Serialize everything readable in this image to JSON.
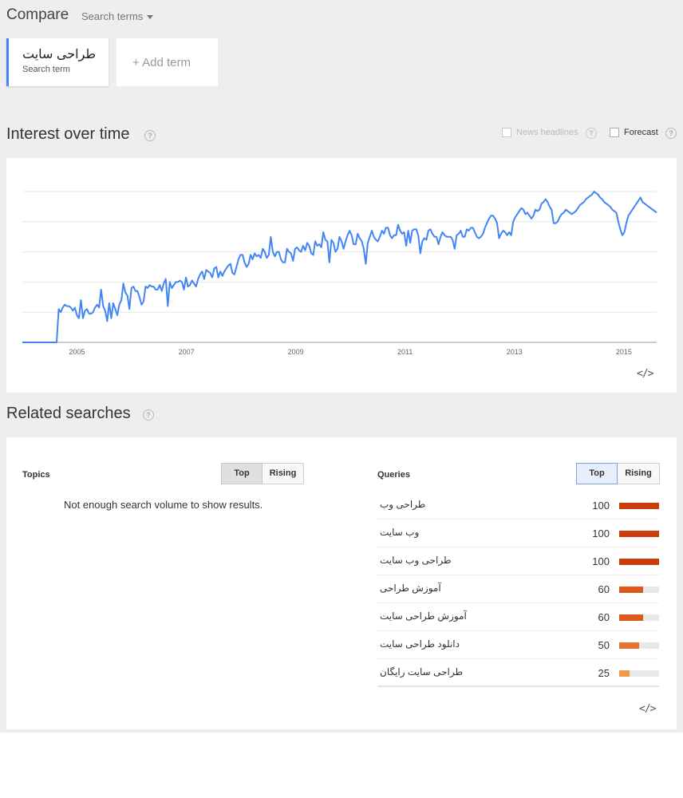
{
  "header": {
    "compare_title": "Compare",
    "search_terms_label": "Search terms",
    "term": {
      "text": "طراحی سایت",
      "sub": "Search term",
      "accent": "#4285f4"
    },
    "add_term": "+ Add term"
  },
  "interest": {
    "title": "Interest over time",
    "news_headlines": "News headlines",
    "forecast": "Forecast",
    "help": "?"
  },
  "chart_data": {
    "type": "line",
    "x_start": 2004.0,
    "x_end": 2015.6,
    "x_ticks": [
      "2005",
      "2007",
      "2009",
      "2011",
      "2013",
      "2015"
    ],
    "x_tick_values": [
      2005,
      2007,
      2009,
      2011,
      2013,
      2015
    ],
    "ylim": [
      0,
      100
    ],
    "grid": true,
    "line_color": "#4285f4",
    "series": [
      {
        "values": [
          0,
          0,
          0,
          0,
          0,
          0,
          0,
          0,
          0,
          0,
          0,
          0,
          0,
          0,
          0,
          0,
          0,
          0,
          22,
          20,
          23,
          25,
          24,
          24,
          23,
          21,
          23,
          18,
          16,
          28,
          16,
          21,
          22,
          19,
          19,
          20,
          23,
          25,
          23,
          35,
          24,
          21,
          14,
          26,
          16,
          26,
          22,
          18,
          25,
          28,
          39,
          33,
          31,
          22,
          36,
          37,
          34,
          34,
          30,
          25,
          27,
          37,
          36,
          38,
          37,
          37,
          35,
          35,
          38,
          34,
          39,
          42,
          24,
          40,
          36,
          38,
          40,
          40,
          41,
          40,
          35,
          43,
          37,
          38,
          41,
          39,
          37,
          42,
          45,
          47,
          42,
          48,
          47,
          46,
          43,
          49,
          50,
          43,
          47,
          44,
          47,
          49,
          51,
          52,
          46,
          45,
          50,
          55,
          58,
          58,
          53,
          50,
          52,
          58,
          55,
          59,
          57,
          58,
          56,
          62,
          60,
          56,
          58,
          70,
          60,
          57,
          60,
          60,
          55,
          53,
          53,
          62,
          60,
          59,
          54,
          62,
          63,
          61,
          60,
          64,
          61,
          66,
          64,
          59,
          58,
          67,
          64,
          65,
          63,
          73,
          68,
          67,
          53,
          68,
          66,
          60,
          62,
          70,
          67,
          62,
          67,
          71,
          74,
          71,
          65,
          65,
          72,
          69,
          67,
          62,
          52,
          66,
          70,
          74,
          70,
          68,
          67,
          70,
          74,
          72,
          76,
          76,
          71,
          69,
          71,
          71,
          78,
          74,
          72,
          73,
          64,
          74,
          66,
          74,
          75,
          75,
          71,
          59,
          67,
          69,
          68,
          74,
          75,
          72,
          70,
          70,
          65,
          70,
          73,
          71,
          70,
          70,
          70,
          68,
          62,
          71,
          72,
          74,
          70,
          70,
          75,
          74,
          76,
          76,
          73,
          70,
          69,
          70,
          72,
          76,
          79,
          82,
          84,
          84,
          82,
          79,
          69,
          72,
          74,
          73,
          71,
          73,
          71,
          80,
          83,
          85,
          87,
          89,
          88,
          85,
          86,
          84,
          82,
          84,
          88,
          87,
          88,
          92,
          93,
          95,
          93,
          90,
          88,
          79,
          79,
          80,
          83,
          85,
          86,
          88,
          87,
          86,
          85,
          86,
          87,
          89,
          91,
          92,
          93,
          95,
          96,
          97,
          98,
          100,
          99,
          98,
          96,
          95,
          93,
          92,
          91,
          90,
          88,
          87,
          86,
          80,
          75,
          71,
          73,
          79,
          84,
          86,
          88,
          90,
          92,
          94,
          96,
          93,
          92,
          91,
          90,
          89,
          88,
          87,
          86
        ]
      }
    ]
  },
  "related": {
    "title": "Related searches",
    "help": "?",
    "topics": {
      "title": "Topics",
      "top": "Top",
      "rising": "Rising",
      "empty": "Not enough search volume to show results."
    },
    "queries": {
      "title": "Queries",
      "top": "Top",
      "rising": "Rising",
      "items": [
        {
          "label": "طراحی وب",
          "value": "100",
          "pct": 100,
          "color": "#cc3d0c"
        },
        {
          "label": "وب سایت",
          "value": "100",
          "pct": 100,
          "color": "#cc3d0c"
        },
        {
          "label": "طراحی وب سایت",
          "value": "100",
          "pct": 100,
          "color": "#cc3d0c"
        },
        {
          "label": "آموزش طراحی",
          "value": "60",
          "pct": 60,
          "color": "#dd5a1e"
        },
        {
          "label": "آموزش طراحی سایت",
          "value": "60",
          "pct": 60,
          "color": "#dd5a1e"
        },
        {
          "label": "دانلود طراحی سایت",
          "value": "50",
          "pct": 50,
          "color": "#e57330"
        },
        {
          "label": "طراحی سایت رایگان",
          "value": "25",
          "pct": 25,
          "color": "#ef9a47"
        }
      ]
    }
  },
  "icons": {
    "embed": "embed-code-icon",
    "help": "help-icon"
  },
  "embed_glyph": "</>"
}
